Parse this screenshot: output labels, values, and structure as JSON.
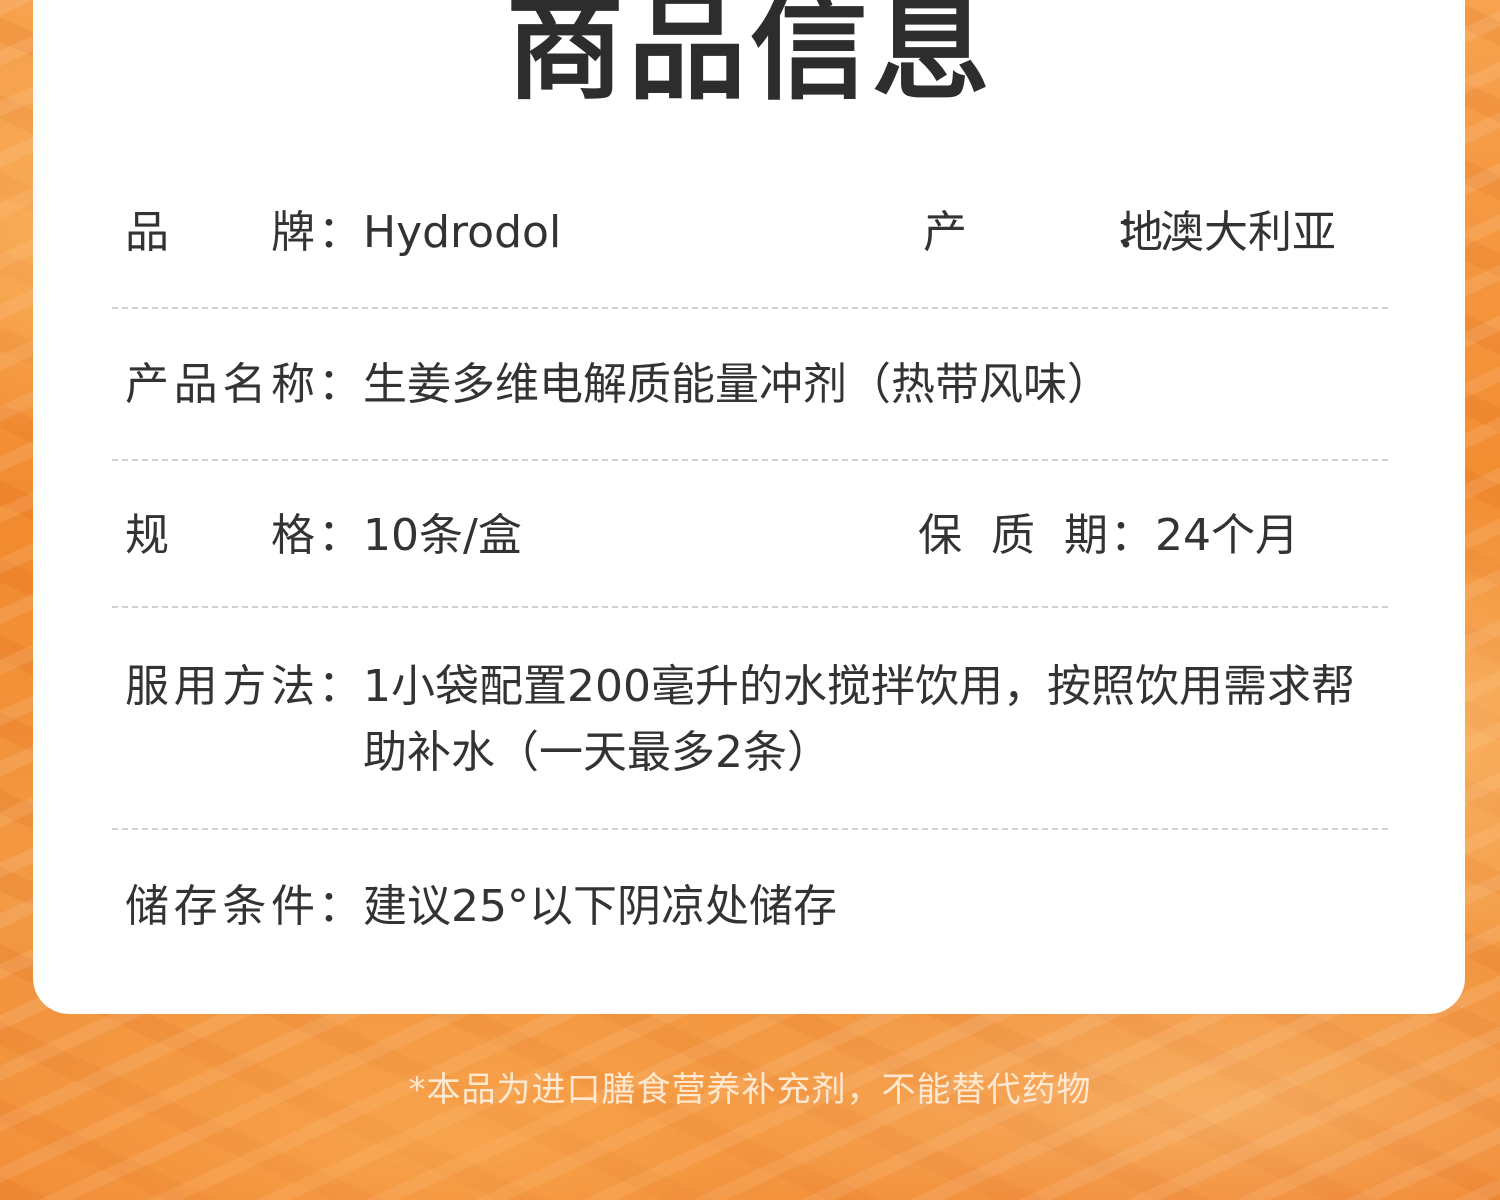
{
  "title": "商品信息",
  "rows": {
    "brand": {
      "label": "品牌",
      "value": "Hydrodol"
    },
    "origin": {
      "label": "产地",
      "value": "澳大利亚"
    },
    "product_name": {
      "label": "产品名称",
      "value": "生姜多维电解质能量冲剂（热带风味）"
    },
    "spec": {
      "label": "规格",
      "value": "10条/盒"
    },
    "shelf_life": {
      "label": "保质期",
      "value": "24个月"
    },
    "usage": {
      "label": "服用方法",
      "value": "1小袋配置200毫升的水搅拌饮用，按照饮用需求帮助补水（一天最多2条）"
    },
    "storage": {
      "label": "储存条件",
      "value": "建议25°以下阴凉处储存"
    }
  },
  "colon": "：",
  "footnote": "*本品为进口膳食营养补充剂，不能替代药物"
}
